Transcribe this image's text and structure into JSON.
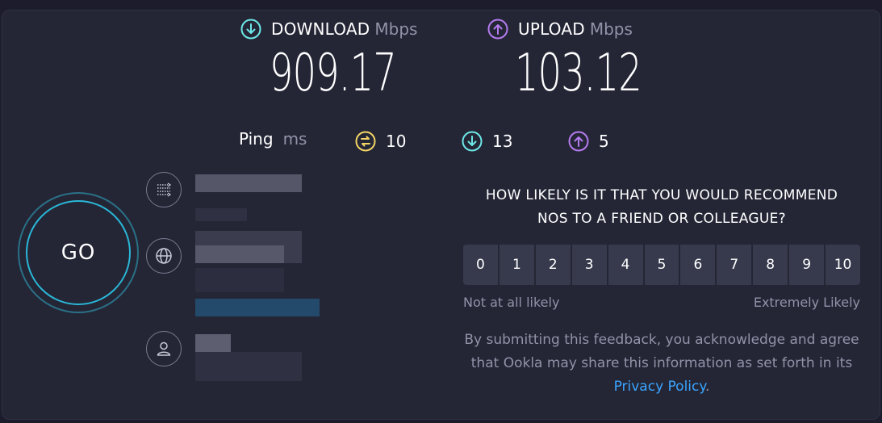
{
  "download": {
    "label": "DOWNLOAD",
    "unit": "Mbps",
    "value": "909.17",
    "icon": "download-arrow-icon",
    "color": "#6ee7e7"
  },
  "upload": {
    "label": "UPLOAD",
    "unit": "Mbps",
    "value": "103.12",
    "icon": "upload-arrow-icon",
    "color": "#b57bef"
  },
  "ping": {
    "label": "Ping",
    "unit": "ms",
    "idle": {
      "value": "10",
      "icon": "ping-idle-icon",
      "color": "#f2d563"
    },
    "download": {
      "value": "13",
      "icon": "ping-download-icon",
      "color": "#6ee7e7"
    },
    "upload": {
      "value": "5",
      "icon": "ping-upload-icon",
      "color": "#b57bef"
    }
  },
  "go_button": {
    "label": "GO"
  },
  "side_icons": [
    "connections-icon",
    "globe-icon",
    "user-icon"
  ],
  "nps": {
    "question_line1": "HOW LIKELY IS IT THAT YOU WOULD RECOMMEND",
    "question_line2": "NOS TO A FRIEND OR COLLEAGUE?",
    "scale": [
      "0",
      "1",
      "2",
      "3",
      "4",
      "5",
      "6",
      "7",
      "8",
      "9",
      "10"
    ],
    "low_label": "Not at all likely",
    "high_label": "Extremely Likely",
    "disclaimer_part1": "By submitting this feedback, you acknowledge and agree that Ookla may share this information as set forth in its ",
    "privacy_link": "Privacy Policy",
    "disclaimer_end": "."
  },
  "colors": {
    "background": "#242636",
    "accent_link": "#3aa4ff",
    "go_ring": "#2ab7d6"
  }
}
